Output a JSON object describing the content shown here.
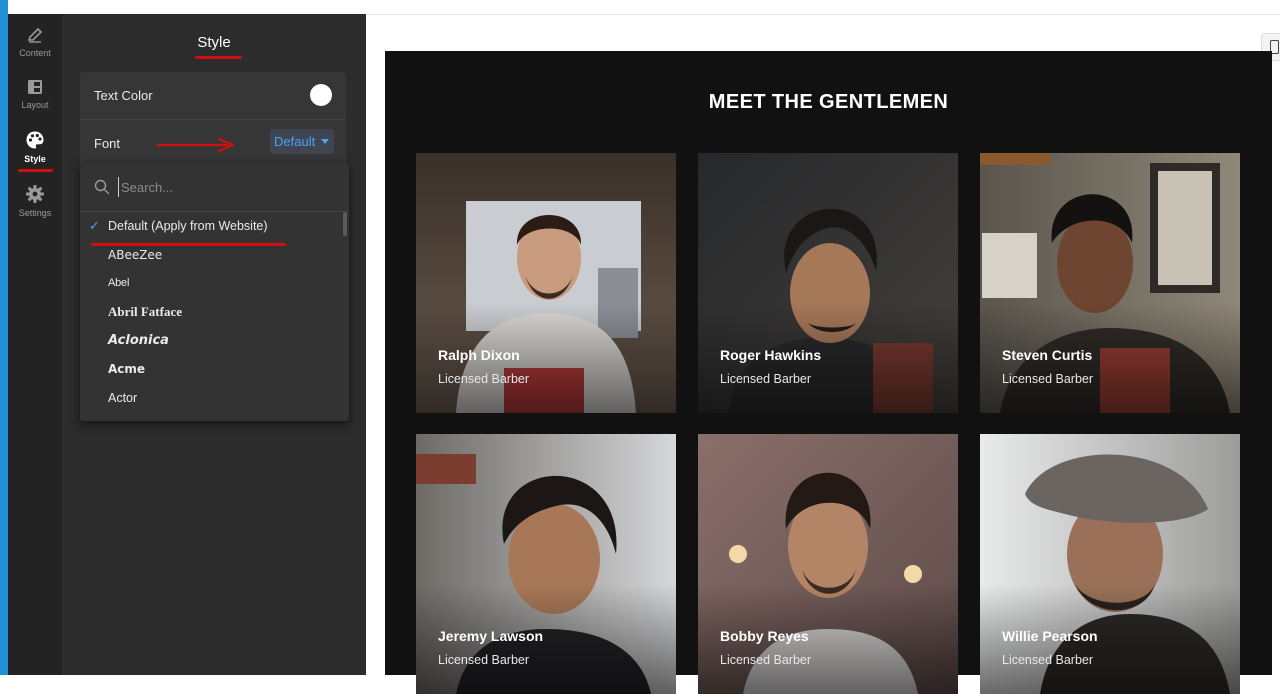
{
  "rail": {
    "items": [
      {
        "label": "Content",
        "icon": "pencil-icon"
      },
      {
        "label": "Layout",
        "icon": "layout-icon"
      },
      {
        "label": "Style",
        "icon": "palette-icon",
        "active": true
      },
      {
        "label": "Settings",
        "icon": "gear-icon"
      }
    ]
  },
  "panel": {
    "title": "Style",
    "text_color_label": "Text Color",
    "text_color_value": "#ffffff",
    "font_label": "Font",
    "font_value": "Default"
  },
  "font_dropdown": {
    "search_placeholder": "Search...",
    "options": [
      {
        "label": "Default (Apply from Website)",
        "selected": true
      },
      {
        "label": "ABeeZee"
      },
      {
        "label": "Abel"
      },
      {
        "label": "Abril Fatface"
      },
      {
        "label": "Aclonica"
      },
      {
        "label": "Acme"
      },
      {
        "label": "Actor"
      }
    ]
  },
  "preview": {
    "title": "MEET THE GENTLEMEN",
    "members": [
      {
        "name": "Ralph Dixon",
        "role": "Licensed Barber"
      },
      {
        "name": "Roger Hawkins",
        "role": "Licensed Barber"
      },
      {
        "name": "Steven Curtis",
        "role": "Licensed Barber"
      },
      {
        "name": "Jeremy Lawson",
        "role": "Licensed Barber"
      },
      {
        "name": "Bobby Reyes",
        "role": "Licensed Barber"
      },
      {
        "name": "Willie Pearson",
        "role": "Licensed Barber"
      }
    ]
  },
  "colors": {
    "accent_blue": "#4aa3f0",
    "annotation_red": "#d10f0f",
    "preview_background": "#111111"
  }
}
